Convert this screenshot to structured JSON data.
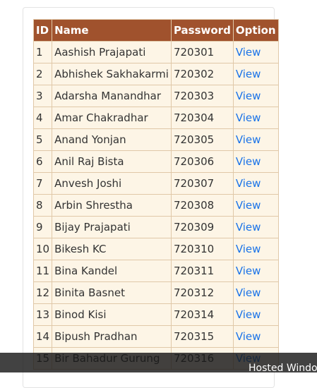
{
  "table": {
    "headers": [
      "ID",
      "Name",
      "Password",
      "Option"
    ],
    "rows": [
      {
        "id": "1",
        "name": "Aashish Prajapati",
        "password": "720301",
        "option": "View"
      },
      {
        "id": "2",
        "name": "Abhishek Sakhakarmi",
        "password": "720302",
        "option": "View"
      },
      {
        "id": "3",
        "name": "Adarsha Manandhar",
        "password": "720303",
        "option": "View"
      },
      {
        "id": "4",
        "name": "Amar Chakradhar",
        "password": "720304",
        "option": "View"
      },
      {
        "id": "5",
        "name": "Anand Yonjan",
        "password": "720305",
        "option": "View"
      },
      {
        "id": "6",
        "name": "Anil Raj Bista",
        "password": "720306",
        "option": "View"
      },
      {
        "id": "7",
        "name": "Anvesh Joshi",
        "password": "720307",
        "option": "View"
      },
      {
        "id": "8",
        "name": "Arbin Shrestha",
        "password": "720308",
        "option": "View"
      },
      {
        "id": "9",
        "name": "Bijay Prajapati",
        "password": "720309",
        "option": "View"
      },
      {
        "id": "10",
        "name": "Bikesh KC",
        "password": "720310",
        "option": "View"
      },
      {
        "id": "11",
        "name": "Bina Kandel",
        "password": "720311",
        "option": "View"
      },
      {
        "id": "12",
        "name": "Binita Basnet",
        "password": "720312",
        "option": "View"
      },
      {
        "id": "13",
        "name": "Binod Kisi",
        "password": "720314",
        "option": "View"
      },
      {
        "id": "14",
        "name": "Bipush Pradhan",
        "password": "720315",
        "option": "View"
      },
      {
        "id": "15",
        "name": "Bir Bahadur Gurung",
        "password": "720316",
        "option": "View"
      }
    ]
  },
  "taskbar": {
    "text": "Hosted Windows"
  },
  "colors": {
    "header_bg": "#a0522d",
    "row_bg": "#fdf5e6",
    "link": "#1a73e8"
  }
}
